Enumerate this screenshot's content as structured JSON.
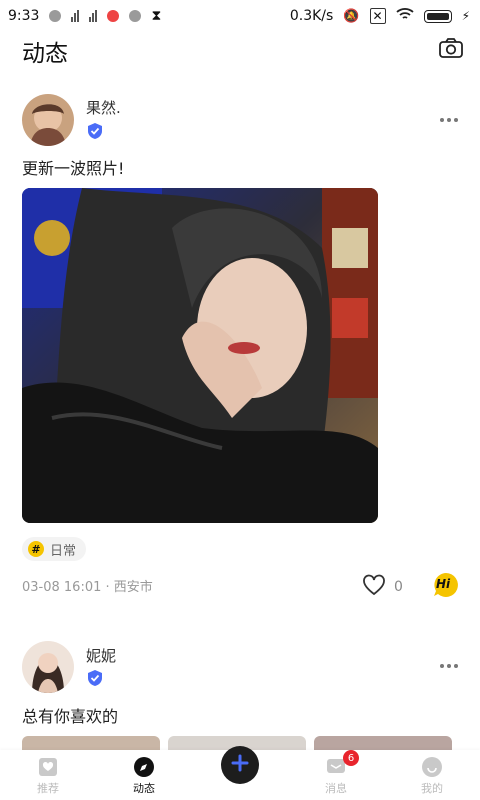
{
  "status": {
    "time": "9:33",
    "speed": "0.3K/s"
  },
  "header": {
    "title": "动态",
    "camera_icon": "camera-icon"
  },
  "posts": [
    {
      "username": "果然.",
      "text": "更新一波照片!",
      "tag": "日常",
      "tag_symbol": "#",
      "datetime": "03-08 16:01",
      "location": "西安市",
      "meta": "03-08 16:01 · 西安市",
      "likes": "0",
      "hi_label": "Hi"
    },
    {
      "username": "妮妮",
      "text": "总有你喜欢的"
    }
  ],
  "tabbar": {
    "items": [
      {
        "label": "推荐",
        "icon": "recommend-icon"
      },
      {
        "label": "动态",
        "icon": "compass-icon"
      },
      {
        "label": "",
        "icon": "plus-icon"
      },
      {
        "label": "消息",
        "icon": "message-icon",
        "badge": "6"
      },
      {
        "label": "我的",
        "icon": "profile-icon"
      }
    ]
  },
  "colors": {
    "accent_blue": "#4a6cf7",
    "hi_yellow": "#f5c400",
    "badge_red": "#e8242d"
  }
}
